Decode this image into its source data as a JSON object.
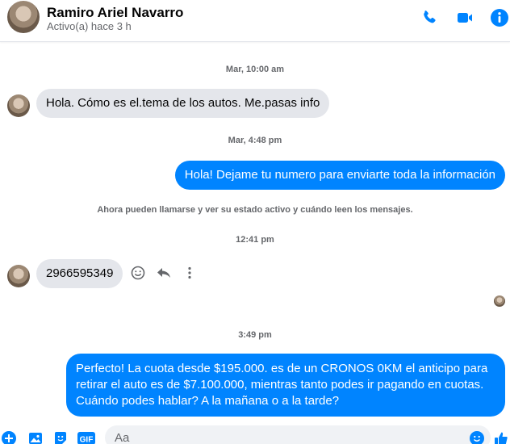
{
  "header": {
    "name": "Ramiro Ariel Navarro",
    "status": "Activo(a) hace 3 h"
  },
  "messages": {
    "ts1": "Mar, 10:00 am",
    "in1": "Hola. Cómo es el.tema de los autos. Me.pasas info",
    "ts2": "Mar, 4:48 pm",
    "out1": "Hola! Dejame tu numero  para enviarte toda la información",
    "notice": "Ahora pueden llamarse y ver su estado activo y cuándo leen los mensajes.",
    "ts3": "12:41 pm",
    "in2": "2966595349",
    "ts4": "3:49 pm",
    "out2": "Perfecto! La cuota desde $195.000. es de un CRONOS 0KM el anticipo para retirar el auto es de $7.100.000, mientras tanto podes ir pagando en cuotas. Cuándo podes hablar? A la mañana o a la tarde?"
  },
  "composer": {
    "placeholder": "Aa"
  },
  "colors": {
    "accent": "#0084ff",
    "incoming_bubble": "#e4e6eb"
  }
}
